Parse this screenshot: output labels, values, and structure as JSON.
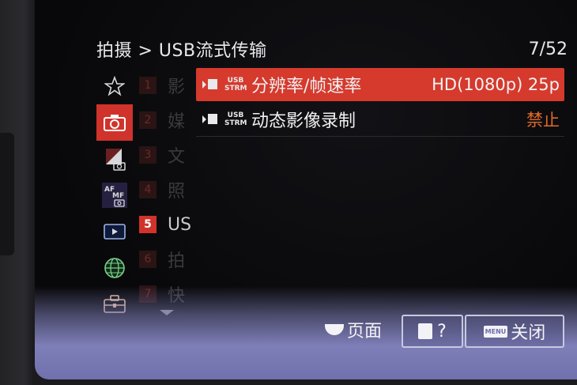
{
  "header": {
    "breadcrumb": "拍摄 > USB流式传输",
    "page_counter": "7/52"
  },
  "categories": [
    {
      "icon": "star-icon",
      "active": false
    },
    {
      "icon": "camera-icon",
      "active": true
    },
    {
      "icon": "exposure-camera-icon",
      "active": false
    },
    {
      "icon": "af-mf-icon",
      "active": false
    },
    {
      "icon": "playback-icon",
      "active": false
    },
    {
      "icon": "globe-icon",
      "active": false
    },
    {
      "icon": "toolbox-icon",
      "active": false
    }
  ],
  "subtabs": [
    {
      "num": "1",
      "label": "影"
    },
    {
      "num": "2",
      "label": "媒"
    },
    {
      "num": "3",
      "label": "文"
    },
    {
      "num": "4",
      "label": "照"
    },
    {
      "num": "5",
      "label": "US"
    },
    {
      "num": "6",
      "label": "拍"
    },
    {
      "num": "7",
      "label": "快"
    }
  ],
  "menu": {
    "items": [
      {
        "badge_top": "USB",
        "badge_bottom": "STRM",
        "label": "分辨率/帧速率",
        "value": "HD(1080p) 25p"
      },
      {
        "badge_top": "USB",
        "badge_bottom": "STRM",
        "label": "动态影像录制",
        "value": "禁止"
      }
    ]
  },
  "bottom_bar": {
    "page_label": "页面",
    "help_label": "?",
    "menu_key": "MENU",
    "close_label": "关闭"
  },
  "colors": {
    "accent": "#d0332b",
    "warning": "#e06a2a",
    "bottom_bar": "#7e7eb8"
  }
}
